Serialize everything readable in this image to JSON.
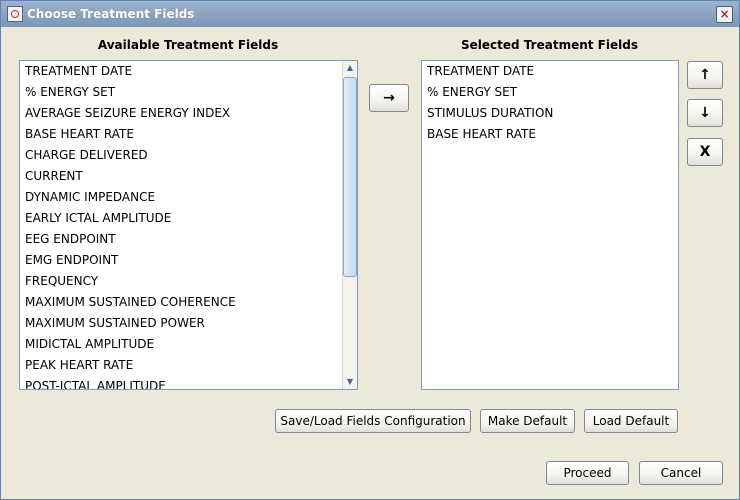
{
  "window": {
    "title": "Choose Treatment Fields",
    "close_icon": "close-icon"
  },
  "available": {
    "heading": "Available Treatment Fields",
    "items": [
      "TREATMENT DATE",
      "% ENERGY SET",
      "AVERAGE SEIZURE ENERGY INDEX",
      "BASE HEART RATE",
      "CHARGE DELIVERED",
      "CURRENT",
      "DYNAMIC IMPEDANCE",
      "EARLY ICTAL AMPLITUDE",
      "EEG ENDPOINT",
      "EMG ENDPOINT",
      "FREQUENCY",
      "MAXIMUM SUSTAINED COHERENCE",
      "MAXIMUM SUSTAINED POWER",
      "MIDICTAL AMPLITUDE",
      "PEAK HEART RATE",
      "POST-ICTAL AMPLITUDE"
    ]
  },
  "selected": {
    "heading": "Selected Treatment Fields",
    "items": [
      "TREATMENT DATE",
      "% ENERGY SET",
      "STIMULUS DURATION",
      "BASE HEART RATE"
    ]
  },
  "controls": {
    "add_label": "→",
    "up_label": "↑",
    "down_label": "↓",
    "remove_label": "X"
  },
  "config_buttons": {
    "save_load": "Save/Load Fields Configuration",
    "make_default": "Make Default",
    "load_default": "Load Default"
  },
  "footer": {
    "proceed": "Proceed",
    "cancel": "Cancel"
  },
  "colors": {
    "title_bar": "#8ea4c2",
    "window_bg": "#ece9d8",
    "list_border": "#7f9db9"
  }
}
